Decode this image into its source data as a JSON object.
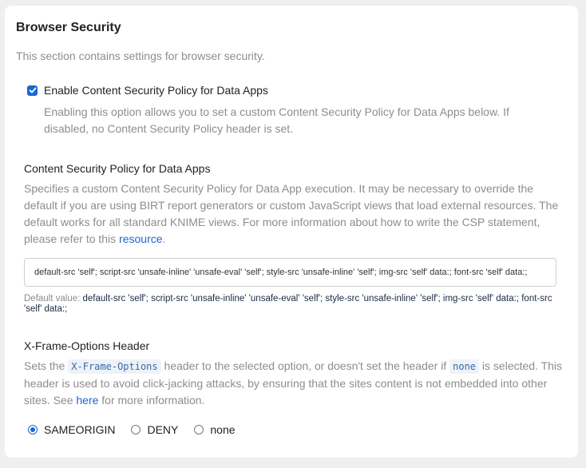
{
  "section": {
    "title": "Browser Security",
    "description": "This section contains settings for browser security."
  },
  "csp_toggle": {
    "label": "Enable Content Security Policy for Data Apps",
    "checked": true,
    "help": "Enabling this option allows you to set a custom Content Security Policy for Data Apps below. If disabled, no Content Security Policy header is set."
  },
  "csp_field": {
    "label": "Content Security Policy for Data Apps",
    "help_text": "Specifies a custom Content Security Policy for Data App execution. It may be necessary to override the default if you are using BIRT report generators or custom JavaScript views that load external resources. The default works for all standard KNIME views. For more information about how to write the CSP statement, please refer to this ",
    "help_link": "resource",
    "help_end": ".",
    "value": "default-src 'self'; script-src 'unsafe-inline' 'unsafe-eval' 'self'; style-src 'unsafe-inline' 'self'; img-src 'self' data:; font-src 'self' data:;",
    "default_label": "Default value: ",
    "default_value": "default-src 'self'; script-src 'unsafe-inline' 'unsafe-eval' 'self'; style-src 'unsafe-inline' 'self'; img-src 'self' data:; font-src 'self' data:;"
  },
  "xframe": {
    "label": "X-Frame-Options Header",
    "help_1": "Sets the ",
    "code_1": "X-Frame-Options",
    "help_2": " header to the selected option, or doesn't set the header if ",
    "code_2": "none",
    "help_3": " is selected. This header is used to avoid click-jacking attacks, by ensuring that the sites content is not embedded into other sites. See ",
    "help_link": "here",
    "help_4": " for more information.",
    "options": [
      {
        "label": "SAMEORIGIN",
        "checked": true
      },
      {
        "label": "DENY",
        "checked": false
      },
      {
        "label": "none",
        "checked": false
      }
    ]
  },
  "colors": {
    "accent": "#1a67d3",
    "muted_text": "#8d8d8d",
    "code_bg": "#ecf3f8"
  }
}
